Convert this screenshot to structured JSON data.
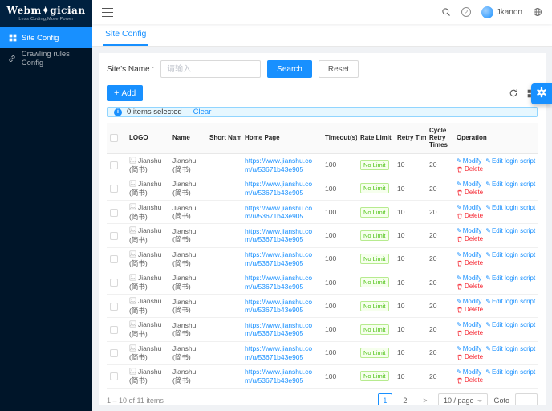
{
  "brand": {
    "name": "Webm✦gician",
    "tagline": "Less Coding,More Power"
  },
  "sidebar": {
    "items": [
      {
        "label": "Site Config",
        "active": true
      },
      {
        "label": "Crawling rules Config",
        "active": false
      }
    ]
  },
  "header": {
    "user": "Jkanon"
  },
  "tabs": [
    {
      "label": "Site Config"
    }
  ],
  "filter": {
    "label": "Site's Name :",
    "placeholder": "请输入",
    "search": "Search",
    "reset": "Reset"
  },
  "toolbar": {
    "add": "Add"
  },
  "selection_bar": {
    "text": "0 items selected",
    "clear": "Clear"
  },
  "icons": {
    "plus": "+",
    "help": "?",
    "info": "i",
    "pencil": "✎",
    "next_page": ">"
  },
  "table": {
    "columns": [
      "LOGO",
      "Name",
      "Short Name",
      "Home Page",
      "Timeout(s)",
      "Rate Limit",
      "Retry Times",
      "Cycle Retry Times",
      "Operation"
    ],
    "operations": {
      "modify": "Modify",
      "edit_login_script": "Edit login script",
      "delete": "Delete"
    },
    "rows": [
      {
        "logo_alt": "Jianshu (简书)",
        "name": "Jianshu (简书)",
        "short_name": "",
        "home_page": "https://www.jianshu.com/u/53671b43e905",
        "timeout": "100",
        "rate_limit": "No Limit",
        "retry_times": "10",
        "cycle_retry_times": "20"
      },
      {
        "logo_alt": "Jianshu (简书)",
        "name": "Jianshu (简书)",
        "short_name": "",
        "home_page": "https://www.jianshu.com/u/53671b43e905",
        "timeout": "100",
        "rate_limit": "No Limit",
        "retry_times": "10",
        "cycle_retry_times": "20"
      },
      {
        "logo_alt": "Jianshu (简书)",
        "name": "Jianshu (简书)",
        "short_name": "",
        "home_page": "https://www.jianshu.com/u/53671b43e905",
        "timeout": "100",
        "rate_limit": "No Limit",
        "retry_times": "10",
        "cycle_retry_times": "20"
      },
      {
        "logo_alt": "Jianshu (简书)",
        "name": "Jianshu (简书)",
        "short_name": "",
        "home_page": "https://www.jianshu.com/u/53671b43e905",
        "timeout": "100",
        "rate_limit": "No Limit",
        "retry_times": "10",
        "cycle_retry_times": "20"
      },
      {
        "logo_alt": "Jianshu (简书)",
        "name": "Jianshu (简书)",
        "short_name": "",
        "home_page": "https://www.jianshu.com/u/53671b43e905",
        "timeout": "100",
        "rate_limit": "No Limit",
        "retry_times": "10",
        "cycle_retry_times": "20"
      },
      {
        "logo_alt": "Jianshu (简书)",
        "name": "Jianshu (简书)",
        "short_name": "",
        "home_page": "https://www.jianshu.com/u/53671b43e905",
        "timeout": "100",
        "rate_limit": "No Limit",
        "retry_times": "10",
        "cycle_retry_times": "20"
      },
      {
        "logo_alt": "Jianshu (简书)",
        "name": "Jianshu (简书)",
        "short_name": "",
        "home_page": "https://www.jianshu.com/u/53671b43e905",
        "timeout": "100",
        "rate_limit": "No Limit",
        "retry_times": "10",
        "cycle_retry_times": "20"
      },
      {
        "logo_alt": "Jianshu (简书)",
        "name": "Jianshu (简书)",
        "short_name": "",
        "home_page": "https://www.jianshu.com/u/53671b43e905",
        "timeout": "100",
        "rate_limit": "No Limit",
        "retry_times": "10",
        "cycle_retry_times": "20"
      },
      {
        "logo_alt": "Jianshu (简书)",
        "name": "Jianshu (简书)",
        "short_name": "",
        "home_page": "https://www.jianshu.com/u/53671b43e905",
        "timeout": "100",
        "rate_limit": "No Limit",
        "retry_times": "10",
        "cycle_retry_times": "20"
      },
      {
        "logo_alt": "Jianshu (简书)",
        "name": "Jianshu (简书)",
        "short_name": "",
        "home_page": "https://www.jianshu.com/u/53671b43e905",
        "timeout": "100",
        "rate_limit": "No Limit",
        "retry_times": "10",
        "cycle_retry_times": "20"
      }
    ]
  },
  "pagination": {
    "total": "1 – 10 of 11 items",
    "pages": [
      "1",
      "2"
    ],
    "page_size": "10 / page",
    "goto_label": "Goto"
  },
  "colors": {
    "primary": "#1890ff",
    "sidebar_bg": "#001529",
    "tag_green": "#52c41a",
    "delete_red": "#f5222d"
  }
}
